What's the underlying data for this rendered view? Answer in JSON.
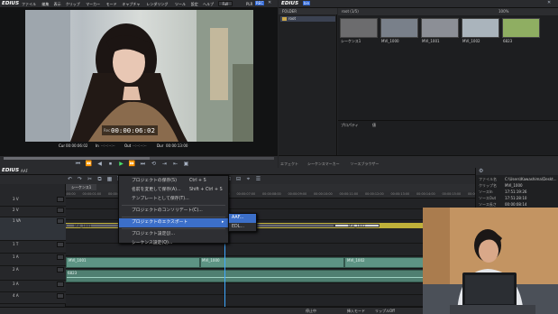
{
  "player": {
    "logo": "EDIUS",
    "menu": [
      "ファイル",
      "編集",
      "表示",
      "クリップ",
      "マーカー",
      "モード",
      "キャプチャ",
      "レンダリング",
      "ツール",
      "設定",
      "ヘルプ"
    ],
    "project_label": "Full",
    "plr": "PLR",
    "rec": "REC",
    "timecode": "00:00:06:02",
    "tc_prefix": "Rec",
    "cur_label": "Cur",
    "cur_value": "00:00:06:02",
    "in_label": "In",
    "in_value": "--:--:--:--",
    "out_label": "Out",
    "out_value": "--:--:--:--",
    "dur_label": "Dur",
    "dur_value": "00:00:13:00"
  },
  "bin": {
    "logo": "EDIUS",
    "badge": "bin",
    "folder_header": "FOLDER",
    "root": "root",
    "path": "root (1/5)",
    "zoom": "100%",
    "clips": [
      {
        "name": "シーケンス1",
        "color": "#6c6c6e"
      },
      {
        "name": "MVI_1000",
        "color": "#79808a"
      },
      {
        "name": "MVI_1001",
        "color": "#8c8f96"
      },
      {
        "name": "MVI_1002",
        "color": "#aab4bc"
      },
      {
        "name": "6823",
        "color": "#8fae62"
      }
    ],
    "property_tab": "プロパティ",
    "info_tab": "値"
  },
  "palette_tabs": [
    "エフェクト",
    "シーケンスマーカー",
    "ソースブラウザー"
  ],
  "timeline": {
    "logo": "EDIUS",
    "badge": "AAF",
    "sequence_tab": "シーケンス1",
    "ruler": [
      "00:00:00:00",
      "00:00:01:00",
      "00:00:02:00",
      "00:00:03:00",
      "00:00:04:00",
      "00:00:05:00",
      "00:00:06:00",
      "00:00:07:00",
      "00:00:08:00",
      "00:00:09:00",
      "00:00:10:00",
      "00:00:11:00",
      "00:00:12:00",
      "00:00:13:00",
      "00:00:14:00",
      "00:00:15:00",
      "00:00:16:00"
    ],
    "tracks": [
      {
        "name": "3 V",
        "type": "V"
      },
      {
        "name": "2 V",
        "type": "V"
      },
      {
        "name": "1 VA",
        "type": "VA"
      },
      {
        "name": "1 T",
        "type": "T"
      },
      {
        "name": "1 A",
        "type": "A"
      },
      {
        "name": "2 A",
        "type": "A"
      },
      {
        "name": "3 A",
        "type": "A"
      },
      {
        "name": "4 A",
        "type": "A"
      }
    ],
    "video_clips": [
      "MVI_1001",
      "MVI_1000",
      "MVI_1002"
    ],
    "audio_clips": [
      "MVI_1001",
      "MVI_1000",
      "MVI_1002"
    ],
    "audio2_clip": "6823",
    "status": [
      "停止中",
      "挿入モード",
      "リップルOff"
    ],
    "disk_status": "ディスク:80%使用(D:)",
    "mode": "タイムライン"
  },
  "info_panel": {
    "rows": [
      {
        "k": "ファイル名",
        "v": "C:\\Users\\Kawashima\\Deskt..."
      },
      {
        "k": "クリップ名",
        "v": "MVI_1000"
      },
      {
        "k": "ソースIn",
        "v": "17:51:19:26"
      },
      {
        "k": "ソースOut",
        "v": "17:51:28:10"
      },
      {
        "k": "ソース長さ",
        "v": "00:00:08:14"
      }
    ]
  },
  "context_menu": {
    "items": [
      {
        "label": "プロジェクトの保存(S)",
        "shortcut": "Ctrl + S"
      },
      {
        "label": "名前を変更して保存(A)...",
        "shortcut": "Shift + Ctrl + S"
      },
      {
        "label": "テンプレートとして保存(T)...",
        "shortcut": ""
      },
      {
        "label": "プロジェクトのコンソリデート(C)...",
        "shortcut": ""
      },
      {
        "label": "プロジェクトのエクスポート",
        "shortcut": ""
      },
      {
        "label": "プロジェクト設定(J)...",
        "shortcut": ""
      },
      {
        "label": "シーケンス設定(Q)...",
        "shortcut": ""
      }
    ],
    "submenu": [
      "AAF...",
      "EDL..."
    ]
  }
}
